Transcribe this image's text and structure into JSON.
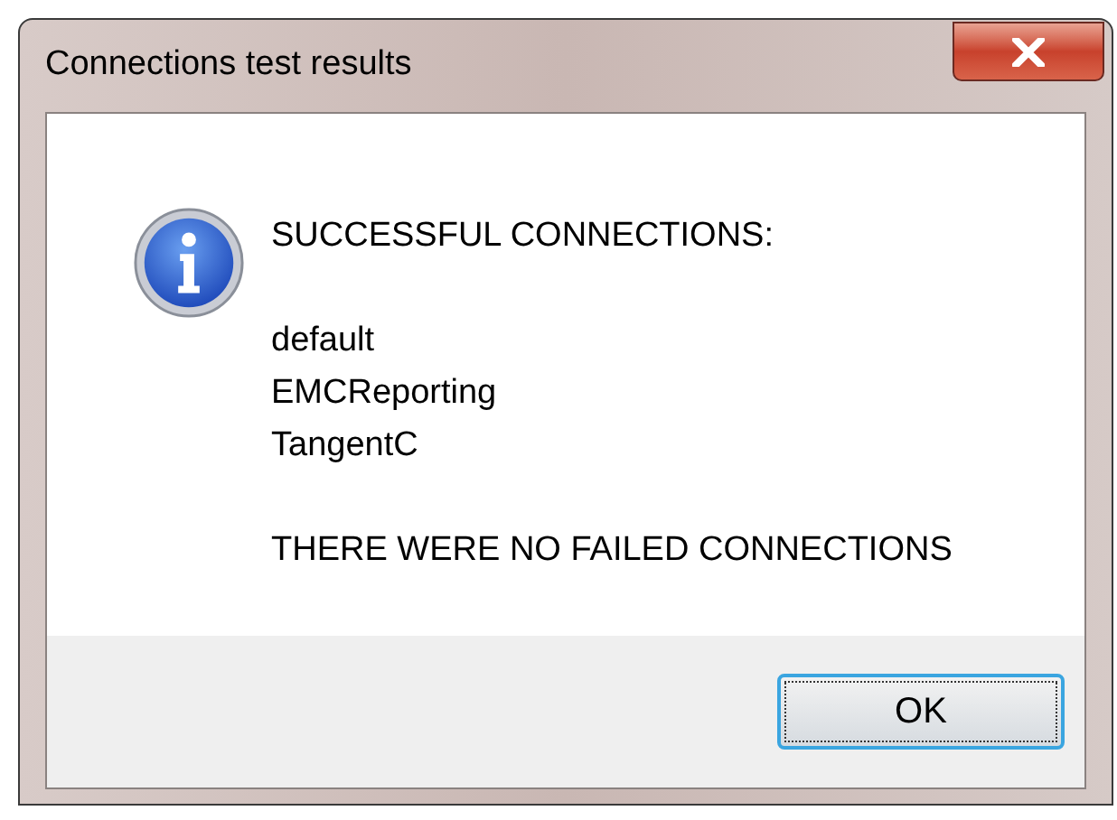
{
  "window": {
    "title": "Connections test results"
  },
  "message": {
    "heading": "SUCCESSFUL CONNECTIONS:",
    "connections": [
      "default",
      "EMCReporting",
      "TangentC"
    ],
    "footer": "THERE WERE NO FAILED CONNECTIONS"
  },
  "buttons": [
    {
      "label": "OK",
      "focused": true
    }
  ]
}
